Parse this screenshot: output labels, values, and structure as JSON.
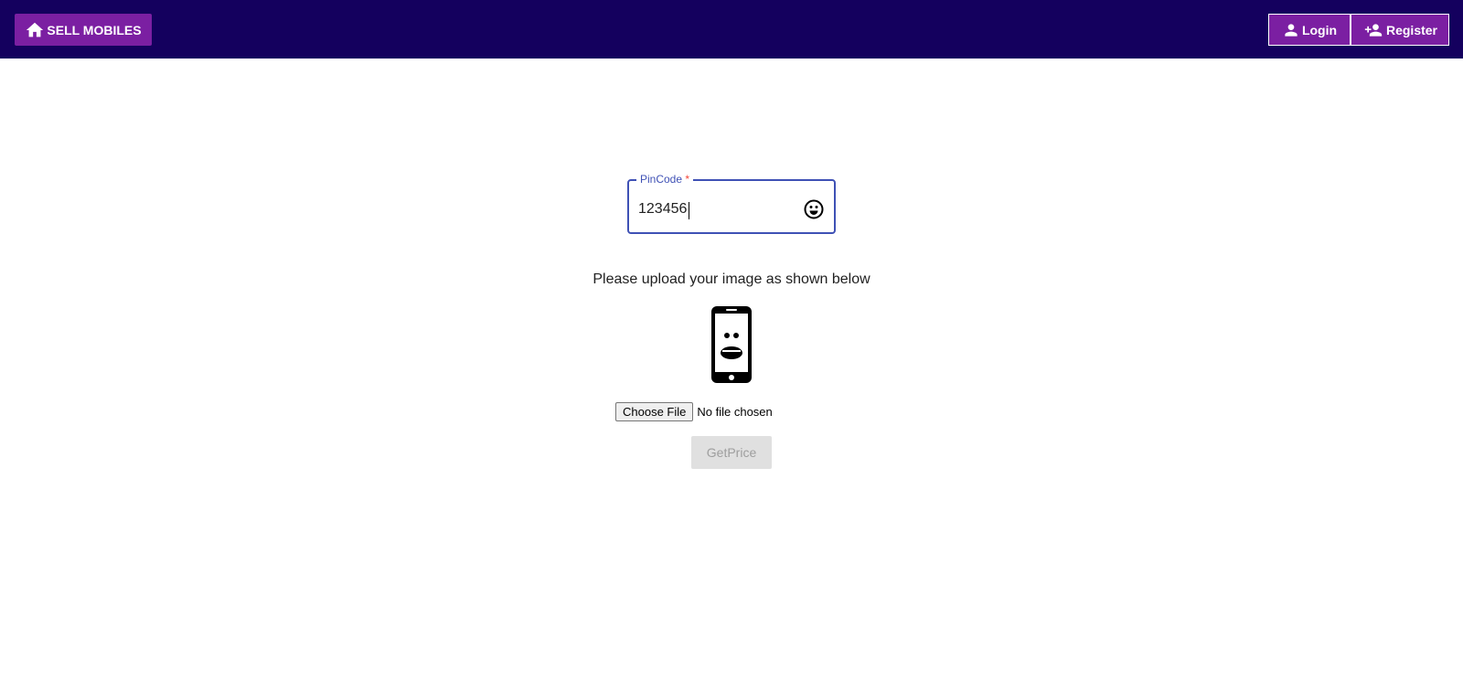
{
  "header": {
    "brand_label": "SELL MOBILES",
    "brand_icon": "home-icon",
    "login_label": "Login",
    "login_icon": "person-icon",
    "register_label": "Register",
    "register_icon": "person-add-icon",
    "background_color": "#14005e",
    "accent_color": "#7b1fa2"
  },
  "form": {
    "pincode": {
      "label": "PinCode",
      "required_mark": "*",
      "value": "123456",
      "icon": "smiley-face-icon",
      "focus_color": "#3f51b5"
    },
    "upload_instruction": "Please upload your image as shown below",
    "example_image_icon": "phone-face-icon",
    "file_input": {
      "button_label": "Choose File",
      "status": "No file chosen"
    },
    "submit_label": "GetPrice",
    "submit_disabled": true
  }
}
